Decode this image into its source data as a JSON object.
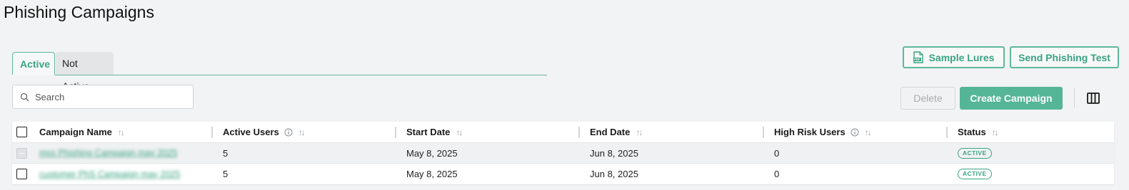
{
  "page": {
    "title": "Phishing Campaigns"
  },
  "tabs": [
    {
      "label": "Active",
      "selected": true
    },
    {
      "label": "Not Active",
      "selected": false
    }
  ],
  "toolbar": {
    "sample_lures_label": "Sample Lures",
    "send_phishing_test_label": "Send Phishing Test",
    "delete_label": "Delete",
    "create_campaign_label": "Create Campaign"
  },
  "search": {
    "placeholder": "Search",
    "value": ""
  },
  "table": {
    "columns": [
      {
        "label": "Campaign Name",
        "has_info": false
      },
      {
        "label": "Active Users",
        "has_info": true
      },
      {
        "label": "Start Date",
        "has_info": false
      },
      {
        "label": "End Date",
        "has_info": false
      },
      {
        "label": "High Risk Users",
        "has_info": true
      },
      {
        "label": "Status",
        "has_info": false
      }
    ],
    "rows": [
      {
        "campaign_name": "mss Phishing Campaign may 2025",
        "active_users": "5",
        "start_date": "May 8, 2025",
        "end_date": "Jun 8, 2025",
        "high_risk_users": "0",
        "status": "ACTIVE",
        "checkbox_disabled": true
      },
      {
        "campaign_name": "customer PhS Campaign may 2025",
        "active_users": "5",
        "start_date": "May 8, 2025",
        "end_date": "Jun 8, 2025",
        "high_risk_users": "0",
        "status": "ACTIVE",
        "checkbox_disabled": false
      }
    ]
  },
  "icons": {
    "sort": "sort-arrows-icon",
    "info": "info-circle-icon",
    "search": "search-icon",
    "pdf": "pdf-file-icon",
    "columns": "columns-icon"
  },
  "colors": {
    "accent": "#3aa383",
    "button_fill": "#55b597",
    "background": "#f2f3f4"
  }
}
